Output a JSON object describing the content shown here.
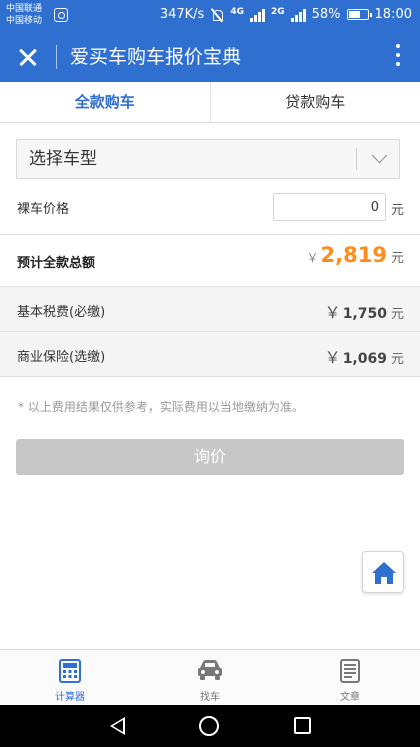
{
  "status_bar": {
    "carrier1": "中国联通",
    "carrier2": "中国移动",
    "speed": "347K/s",
    "net1": "4G",
    "net2": "2G",
    "battery": "58%",
    "time": "18:00"
  },
  "app_bar": {
    "title": "爱买车购车报价宝典"
  },
  "tabs": [
    {
      "label": "全款购车",
      "active": true
    },
    {
      "label": "贷款购车",
      "active": false
    }
  ],
  "form": {
    "car_select": "选择车型",
    "price_label": "裸车价格",
    "price_value": "0",
    "price_unit": "元"
  },
  "summary": {
    "total_label": "预计全款总额",
    "currency_symbol": "￥",
    "total_amount": "2,819",
    "unit": "元"
  },
  "fees": [
    {
      "label": "基本税费(必缴)",
      "symbol": "￥",
      "amount": "1,750",
      "unit": "元"
    },
    {
      "label": "商业保险(选缴)",
      "symbol": "￥",
      "amount": "1,069",
      "unit": "元"
    }
  ],
  "note": "* 以上费用结果仅供参考，实际费用以当地缴纳为准。",
  "inquiry_button": "询价",
  "bottom_nav": [
    {
      "label": "计算器",
      "icon": "calculator-icon",
      "active": true
    },
    {
      "label": "找车",
      "icon": "car-icon",
      "active": false
    },
    {
      "label": "文章",
      "icon": "article-icon",
      "active": false
    }
  ],
  "colors": {
    "primary": "#2f6fd0",
    "accent_orange": "#ff8c1a",
    "disabled_button": "#c7c7c7"
  }
}
